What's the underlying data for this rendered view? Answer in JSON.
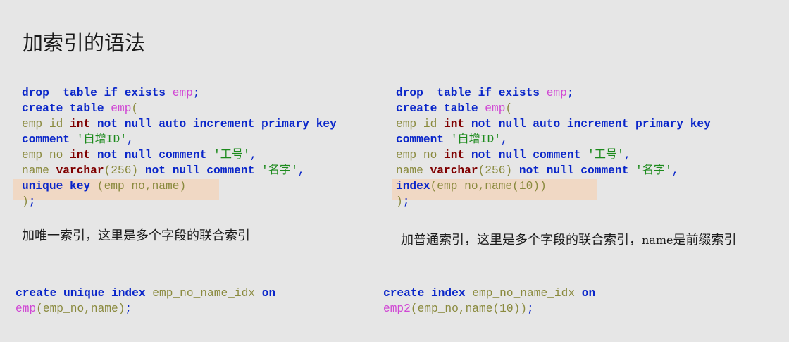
{
  "slide": {
    "title": "加索引的语法"
  },
  "left_code": [
    [
      [
        "kw",
        "drop  table if exists "
      ],
      [
        "tbl",
        "emp"
      ],
      [
        "pun",
        ";"
      ]
    ],
    [
      [
        "kw",
        "create table "
      ],
      [
        "tbl",
        "emp"
      ],
      [
        "id",
        "("
      ]
    ],
    [
      [
        "id",
        "emp_id "
      ],
      [
        "kw2",
        "int"
      ],
      [
        "kw",
        " not null auto_increment primary key"
      ]
    ],
    [
      [
        "kw",
        "comment "
      ],
      [
        "str",
        "'自增ID'"
      ],
      [
        "pun",
        ","
      ]
    ],
    [
      [
        "id",
        "emp_no "
      ],
      [
        "kw2",
        "int"
      ],
      [
        "kw",
        " not null comment "
      ],
      [
        "str",
        "'工号'"
      ],
      [
        "pun",
        ","
      ]
    ],
    [
      [
        "id",
        "name "
      ],
      [
        "kw2",
        "varchar"
      ],
      [
        "id",
        "(256) "
      ],
      [
        "kw",
        "not null comment "
      ],
      [
        "str",
        "'名字'"
      ],
      [
        "pun",
        ","
      ]
    ],
    [
      [
        "kw",
        "unique key "
      ],
      [
        "id",
        "(emp_no,name)"
      ]
    ],
    [
      [
        "id",
        ")"
      ],
      [
        "pun",
        ";"
      ]
    ]
  ],
  "right_code": [
    [
      [
        "kw",
        "drop  table if exists "
      ],
      [
        "tbl",
        "emp"
      ],
      [
        "pun",
        ";"
      ]
    ],
    [
      [
        "kw",
        "create table "
      ],
      [
        "tbl",
        "emp"
      ],
      [
        "id",
        "("
      ]
    ],
    [
      [
        "id",
        "emp_id "
      ],
      [
        "kw2",
        "int"
      ],
      [
        "kw",
        " not null auto_increment primary key"
      ]
    ],
    [
      [
        "kw",
        "comment "
      ],
      [
        "str",
        "'自增ID'"
      ],
      [
        "pun",
        ","
      ]
    ],
    [
      [
        "id",
        "emp_no "
      ],
      [
        "kw2",
        "int"
      ],
      [
        "kw",
        " not null comment "
      ],
      [
        "str",
        "'工号'"
      ],
      [
        "pun",
        ","
      ]
    ],
    [
      [
        "id",
        "name "
      ],
      [
        "kw2",
        "varchar"
      ],
      [
        "id",
        "(256) "
      ],
      [
        "kw",
        "not null comment "
      ],
      [
        "str",
        "'名字'"
      ],
      [
        "pun",
        ","
      ]
    ],
    [
      [
        "kw",
        "index"
      ],
      [
        "id",
        "(emp_no,name(10))"
      ]
    ],
    [
      [
        "id",
        ")"
      ],
      [
        "pun",
        ";"
      ]
    ]
  ],
  "left_note": "加唯一索引，这里是多个字段的联合索引",
  "right_note": {
    "part1": "加普通索引，这里是多个字段的联合索引，",
    "part2": "name",
    "part3": "是前缀索引"
  },
  "left_create": [
    [
      [
        "kw",
        "create unique index "
      ],
      [
        "id",
        "emp_no_name_idx "
      ],
      [
        "kw",
        "on"
      ]
    ],
    [
      [
        "tbl",
        "emp"
      ],
      [
        "id",
        "(emp_no,name)"
      ],
      [
        "pun",
        ";"
      ]
    ]
  ],
  "right_create": [
    [
      [
        "kw",
        "create index "
      ],
      [
        "id",
        "emp_no_name_idx "
      ],
      [
        "kw",
        "on"
      ]
    ],
    [
      [
        "tbl",
        "emp2"
      ],
      [
        "id",
        "(emp_no,name(10))"
      ],
      [
        "pun",
        ";"
      ]
    ]
  ],
  "colors": {
    "keyword": "#0a26c9",
    "type": "#7f0000",
    "table": "#d047d4",
    "identifier": "#8a8a3e",
    "string": "#1c8a1c",
    "highlight": "#f0d8c4",
    "background": "#e6e6e6"
  }
}
